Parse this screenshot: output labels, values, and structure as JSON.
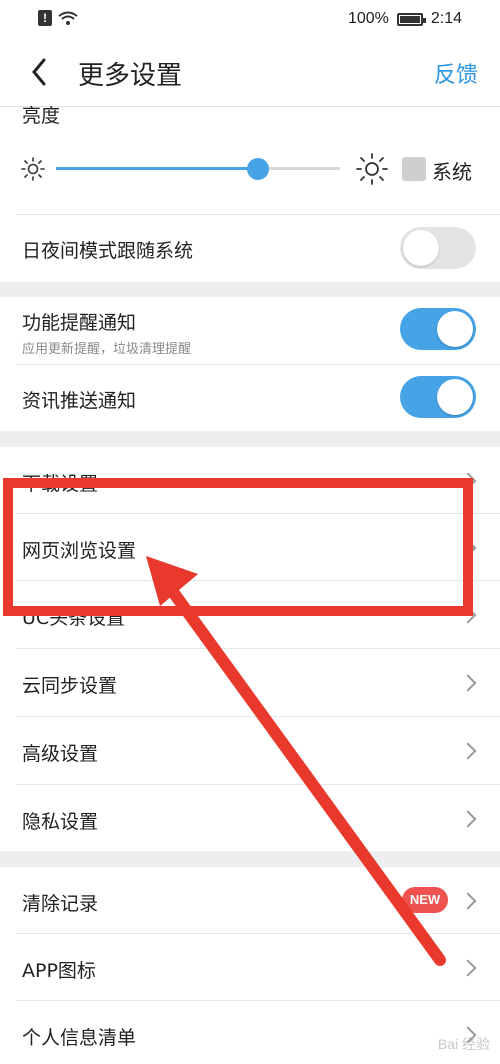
{
  "status_bar": {
    "battery": "100%",
    "time": "2:14"
  },
  "header": {
    "title": "更多设置",
    "feedback": "反馈"
  },
  "brightness": {
    "label": "亮度",
    "level_fraction": 0.71,
    "system_label": "系统"
  },
  "rows": {
    "night_mode": "日夜间模式跟随系统",
    "feature_notify": {
      "label": "功能提醒通知",
      "sub": "应用更新提醒，垃圾清理提醒"
    },
    "news_push": "资讯推送通知",
    "download": "下载设置",
    "web_browse": "网页浏览设置",
    "uc_headline": "UC头条设置",
    "cloud_sync": "云同步设置",
    "advanced": "高级设置",
    "privacy": "隐私设置",
    "clear_records": "清除记录",
    "app_icon": "APP图标",
    "personal_info": "个人信息清单"
  },
  "badge": {
    "new": "NEW"
  },
  "colors": {
    "accent": "#46a3e6",
    "annotation": "#e8392c"
  },
  "watermark": "Bai 经验"
}
